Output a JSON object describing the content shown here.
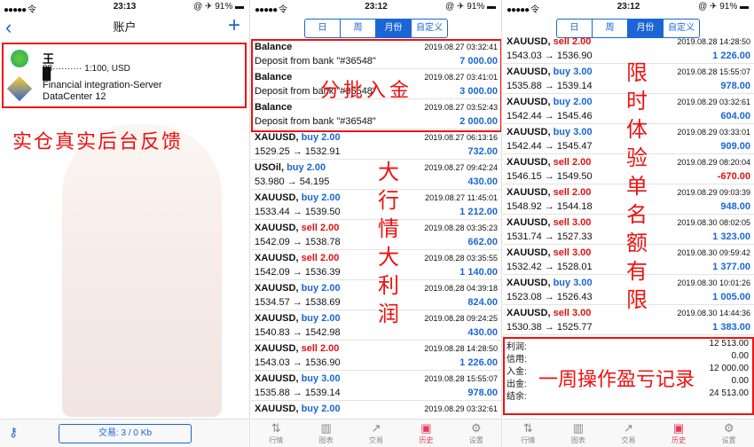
{
  "status": {
    "signal": "●●●●● 令",
    "time": "23:13",
    "time2": "23:12",
    "time3": "23:12",
    "right": "@ ✈ 91% ▬"
  },
  "account": {
    "title": "账户",
    "name": "王█",
    "number": "88··········  1:100, USD",
    "company": "Financial integration-Server",
    "server": "DataCenter 12",
    "trade_btn": "交易:  3 / 0 Kb"
  },
  "seg": [
    "日",
    "周",
    "月份",
    "自定义"
  ],
  "overlay": {
    "p1": "实仓真实后台反馈",
    "p2_h": "分批入金",
    "p2_v": "大行情大利润",
    "p3_v": "限时体验单名额有限",
    "p3_h": "一周操作盈亏记录"
  },
  "panel2_rows": [
    {
      "kind": "balance",
      "title": "Balance",
      "dt": "2019.08.27 03:32:41",
      "l2": "Deposit from  bank  \"#36548\"",
      "amt": "7 000.00"
    },
    {
      "kind": "balance",
      "title": "Balance",
      "dt": "2019.08.27 03:41:01",
      "l2": "Deposit from  bank  \"#36548\"",
      "amt": "3 000.00"
    },
    {
      "kind": "balance",
      "title": "Balance",
      "dt": "2019.08.27 03:52:43",
      "l2": "Deposit from  bank  \"#36548\"",
      "amt": "2 000.00"
    },
    {
      "sym": "XAUUSD,",
      "side": "buy 2.00",
      "dir": "buy",
      "dt": "2019.08.27 06:13:16",
      "l2": "1529.25 → 1532.91",
      "amt": "732.00"
    },
    {
      "sym": "USOil,",
      "side": "buy 2.00",
      "dir": "buy",
      "dt": "2019.08.27 09:42:24",
      "l2": "53.980 → 54.195",
      "amt": "430.00"
    },
    {
      "sym": "XAUUSD,",
      "side": "buy 2.00",
      "dir": "buy",
      "dt": "2019.08.27 11:45:01",
      "l2": "1533.44 → 1539.50",
      "amt": "1 212.00"
    },
    {
      "sym": "XAUUSD,",
      "side": "sell 2.00",
      "dir": "sell",
      "dt": "2019.08.28 03:35:23",
      "l2": "1542.09 → 1538.78",
      "amt": "662.00"
    },
    {
      "sym": "XAUUSD,",
      "side": "sell 2.00",
      "dir": "sell",
      "dt": "2019.08.28 03:35:55",
      "l2": "1542.09 → 1536.39",
      "amt": "1 140.00"
    },
    {
      "sym": "XAUUSD,",
      "side": "buy 2.00",
      "dir": "buy",
      "dt": "2019.08.28 04:39:18",
      "l2": "1534.57 → 1538.69",
      "amt": "824.00"
    },
    {
      "sym": "XAUUSD,",
      "side": "buy 2.00",
      "dir": "buy",
      "dt": "2019.08.28 09:24:25",
      "l2": "1540.83 → 1542.98",
      "amt": "430.00"
    },
    {
      "sym": "XAUUSD,",
      "side": "sell 2.00",
      "dir": "sell",
      "dt": "2019.08.28 14:28:50",
      "l2": "1543.03 → 1536.90",
      "amt": "1 226.00"
    },
    {
      "sym": "XAUUSD,",
      "side": "buy 3.00",
      "dir": "buy",
      "dt": "2019.08.28 15:55:07",
      "l2": "1535.88 → 1539.14",
      "amt": "978.00"
    },
    {
      "sym": "XAUUSD,",
      "side": "buy 2.00",
      "dir": "buy",
      "dt": "2019.08.29 03:32:61",
      "l2": "",
      "amt": ""
    }
  ],
  "panel3_rows": [
    {
      "sym": "XAUUSD,",
      "side": "sell 2.00",
      "dir": "sell",
      "dt": "2019.08.28 14:28:50",
      "l2": "1543.03 → 1536.90",
      "amt": "1 226.00"
    },
    {
      "sym": "XAUUSD,",
      "side": "buy 3.00",
      "dir": "buy",
      "dt": "2019.08.28 15:55:07",
      "l2": "1535.88 → 1539.14",
      "amt": "978.00"
    },
    {
      "sym": "XAUUSD,",
      "side": "buy 2.00",
      "dir": "buy",
      "dt": "2019.08.29 03:32:61",
      "l2": "1542.44 → 1545.46",
      "amt": "604.00"
    },
    {
      "sym": "XAUUSD,",
      "side": "buy 3.00",
      "dir": "buy",
      "dt": "2019.08.29 03:33:01",
      "l2": "1542.44 → 1545.47",
      "amt": "909.00"
    },
    {
      "sym": "XAUUSD,",
      "side": "sell 2.00",
      "dir": "sell",
      "dt": "2019.08.29 08:20:04",
      "l2": "1546.15 → 1549.50",
      "amt": "-670.00"
    },
    {
      "sym": "XAUUSD,",
      "side": "sell 2.00",
      "dir": "sell",
      "dt": "2019.08.29 09:03:39",
      "l2": "1548.92 → 1544.18",
      "amt": "948.00"
    },
    {
      "sym": "XAUUSD,",
      "side": "sell 3.00",
      "dir": "sell",
      "dt": "2019.08.30 08:02:05",
      "l2": "1531.74 → 1527.33",
      "amt": "1 323.00"
    },
    {
      "sym": "XAUUSD,",
      "side": "sell 3.00",
      "dir": "sell",
      "dt": "2019.08.30 09:59:42",
      "l2": "1532.42 → 1528.01",
      "amt": "1 377.00"
    },
    {
      "sym": "XAUUSD,",
      "side": "buy 3.00",
      "dir": "buy",
      "dt": "2019.08.30 10:01:26",
      "l2": "1523.08 → 1526.43",
      "amt": "1 005.00"
    },
    {
      "sym": "XAUUSD,",
      "side": "sell 3.00",
      "dir": "sell",
      "dt": "2019.08.30 14:44:36",
      "l2": "1530.38 → 1525.77",
      "amt": "1 383.00"
    }
  ],
  "summary": [
    {
      "k": "利润:",
      "v": "12 513.00"
    },
    {
      "k": "信用:",
      "v": "0.00"
    },
    {
      "k": "入金:",
      "v": "12 000.00"
    },
    {
      "k": "出金:",
      "v": "0.00"
    },
    {
      "k": "结余:",
      "v": "24 513.00"
    }
  ],
  "tabs": [
    "行情",
    "图表",
    "交易",
    "历史",
    "设置"
  ]
}
